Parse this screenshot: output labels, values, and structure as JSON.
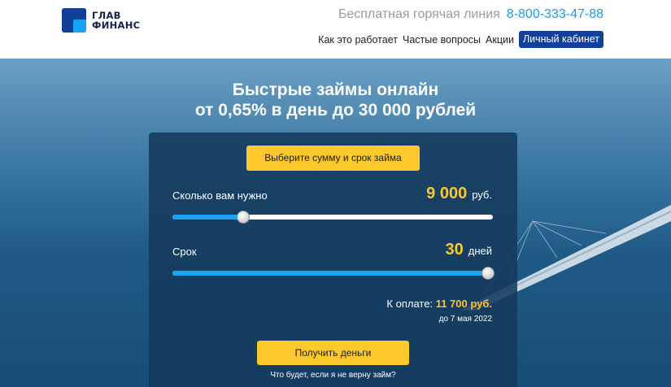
{
  "brand": {
    "logo_line1": "ГЛАВ",
    "logo_line2": "ФИНАНС"
  },
  "header": {
    "hotline_label": "Бесплатная горячая линия",
    "hotline_phone": "8-800-333-47-88",
    "nav": [
      "Как это работает",
      "Частые вопросы",
      "Акции"
    ],
    "cabinet_label": "Личный кабинет"
  },
  "hero": {
    "title_line1": "Быстрые займы онлайн",
    "title_line2": "от 0,65% в день до 30 000 рублей"
  },
  "calculator": {
    "select_button": "Выберите сумму и срок займа",
    "amount": {
      "label": "Сколько вам нужно",
      "value": "9 000",
      "unit": "руб.",
      "slider_fraction": 0.22
    },
    "term": {
      "label": "Срок",
      "value": "30",
      "unit": "дней",
      "slider_fraction": 1.0
    },
    "total_label": "К оплате:",
    "total_amount": "11 700 руб.",
    "due_date": "до 7 мая 2022",
    "submit_button": "Получить деньги",
    "faq_link": "Что будет, если я не верну займ?"
  },
  "colors": {
    "accent_yellow": "#fcc82c",
    "brand_blue": "#123f98",
    "slider_blue": "#1aa3f0",
    "phone_blue": "#1a9ee8"
  }
}
